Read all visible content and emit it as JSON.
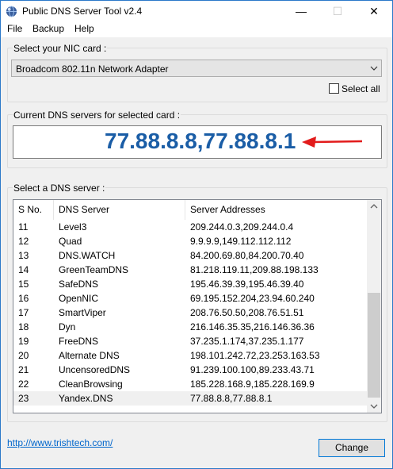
{
  "window": {
    "title": "Public DNS Server Tool v2.4",
    "minimize_glyph": "—",
    "maximize_glyph": "☐",
    "close_glyph": "✕"
  },
  "menu": [
    "File",
    "Backup",
    "Help"
  ],
  "nic": {
    "label": "Select your NIC card :",
    "selected": "Broadcom 802.11n Network Adapter",
    "select_all_label": "Select all",
    "select_all_checked": false
  },
  "current_dns": {
    "label": "Current DNS servers for selected card :",
    "value": "77.88.8.8,77.88.8.1",
    "arrow_color": "#e21b1b",
    "value_color": "#1a5da6"
  },
  "dns_list": {
    "label": "Select a DNS server :",
    "columns": [
      "S No.",
      "DNS Server",
      "Server Addresses"
    ],
    "rows": [
      {
        "sno": "11",
        "name": "Level3",
        "addr": "209.244.0.3,209.244.0.4"
      },
      {
        "sno": "12",
        "name": "Quad",
        "addr": "9.9.9.9,149.112.112.112"
      },
      {
        "sno": "13",
        "name": "DNS.WATCH",
        "addr": "84.200.69.80,84.200.70.40"
      },
      {
        "sno": "14",
        "name": "GreenTeamDNS",
        "addr": "81.218.119.11,209.88.198.133"
      },
      {
        "sno": "15",
        "name": "SafeDNS",
        "addr": "195.46.39.39,195.46.39.40"
      },
      {
        "sno": "16",
        "name": "OpenNIC",
        "addr": "69.195.152.204,23.94.60.240"
      },
      {
        "sno": "17",
        "name": "SmartViper",
        "addr": "208.76.50.50,208.76.51.51"
      },
      {
        "sno": "18",
        "name": "Dyn",
        "addr": "216.146.35.35,216.146.36.36"
      },
      {
        "sno": "19",
        "name": "FreeDNS",
        "addr": "37.235.1.174,37.235.1.177"
      },
      {
        "sno": "20",
        "name": "Alternate DNS",
        "addr": "198.101.242.72,23.253.163.53"
      },
      {
        "sno": "21",
        "name": "UncensoredDNS",
        "addr": "91.239.100.100,89.233.43.71"
      },
      {
        "sno": "22",
        "name": "CleanBrowsing",
        "addr": "185.228.168.9,185.228.169.9"
      },
      {
        "sno": "23",
        "name": "Yandex.DNS",
        "addr": "77.88.8.8,77.88.8.1"
      }
    ],
    "selected_sno": "23"
  },
  "footer": {
    "link": "http://www.trishtech.com/",
    "button": "Change"
  }
}
